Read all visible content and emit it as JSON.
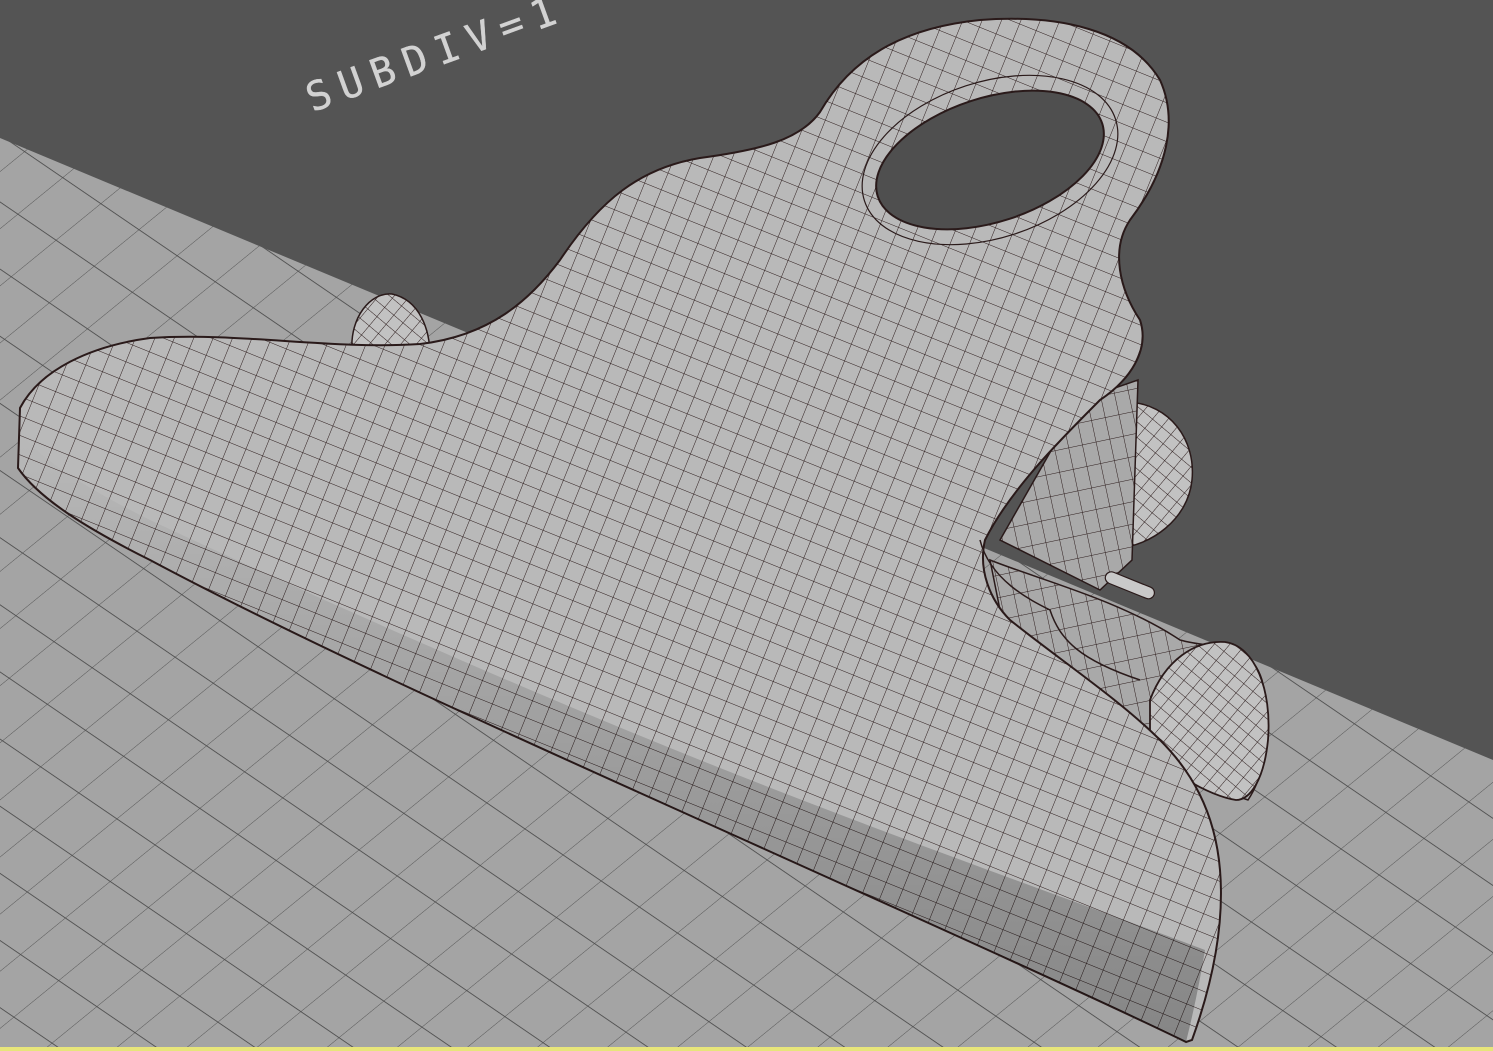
{
  "viewport": {
    "annotation_text": "SUBDIV=1",
    "colors": {
      "background": "#545454",
      "grid_surface": "#a4a4a4",
      "grid_line": "#4a4a4a",
      "mesh_surface": "#b8b8b8",
      "mesh_shade": "#8a8a8a",
      "wire": "#2a1a1a",
      "active_border": "#e7e57a"
    },
    "object_icon_name": "binder-clip-mesh",
    "border_state": "active"
  }
}
